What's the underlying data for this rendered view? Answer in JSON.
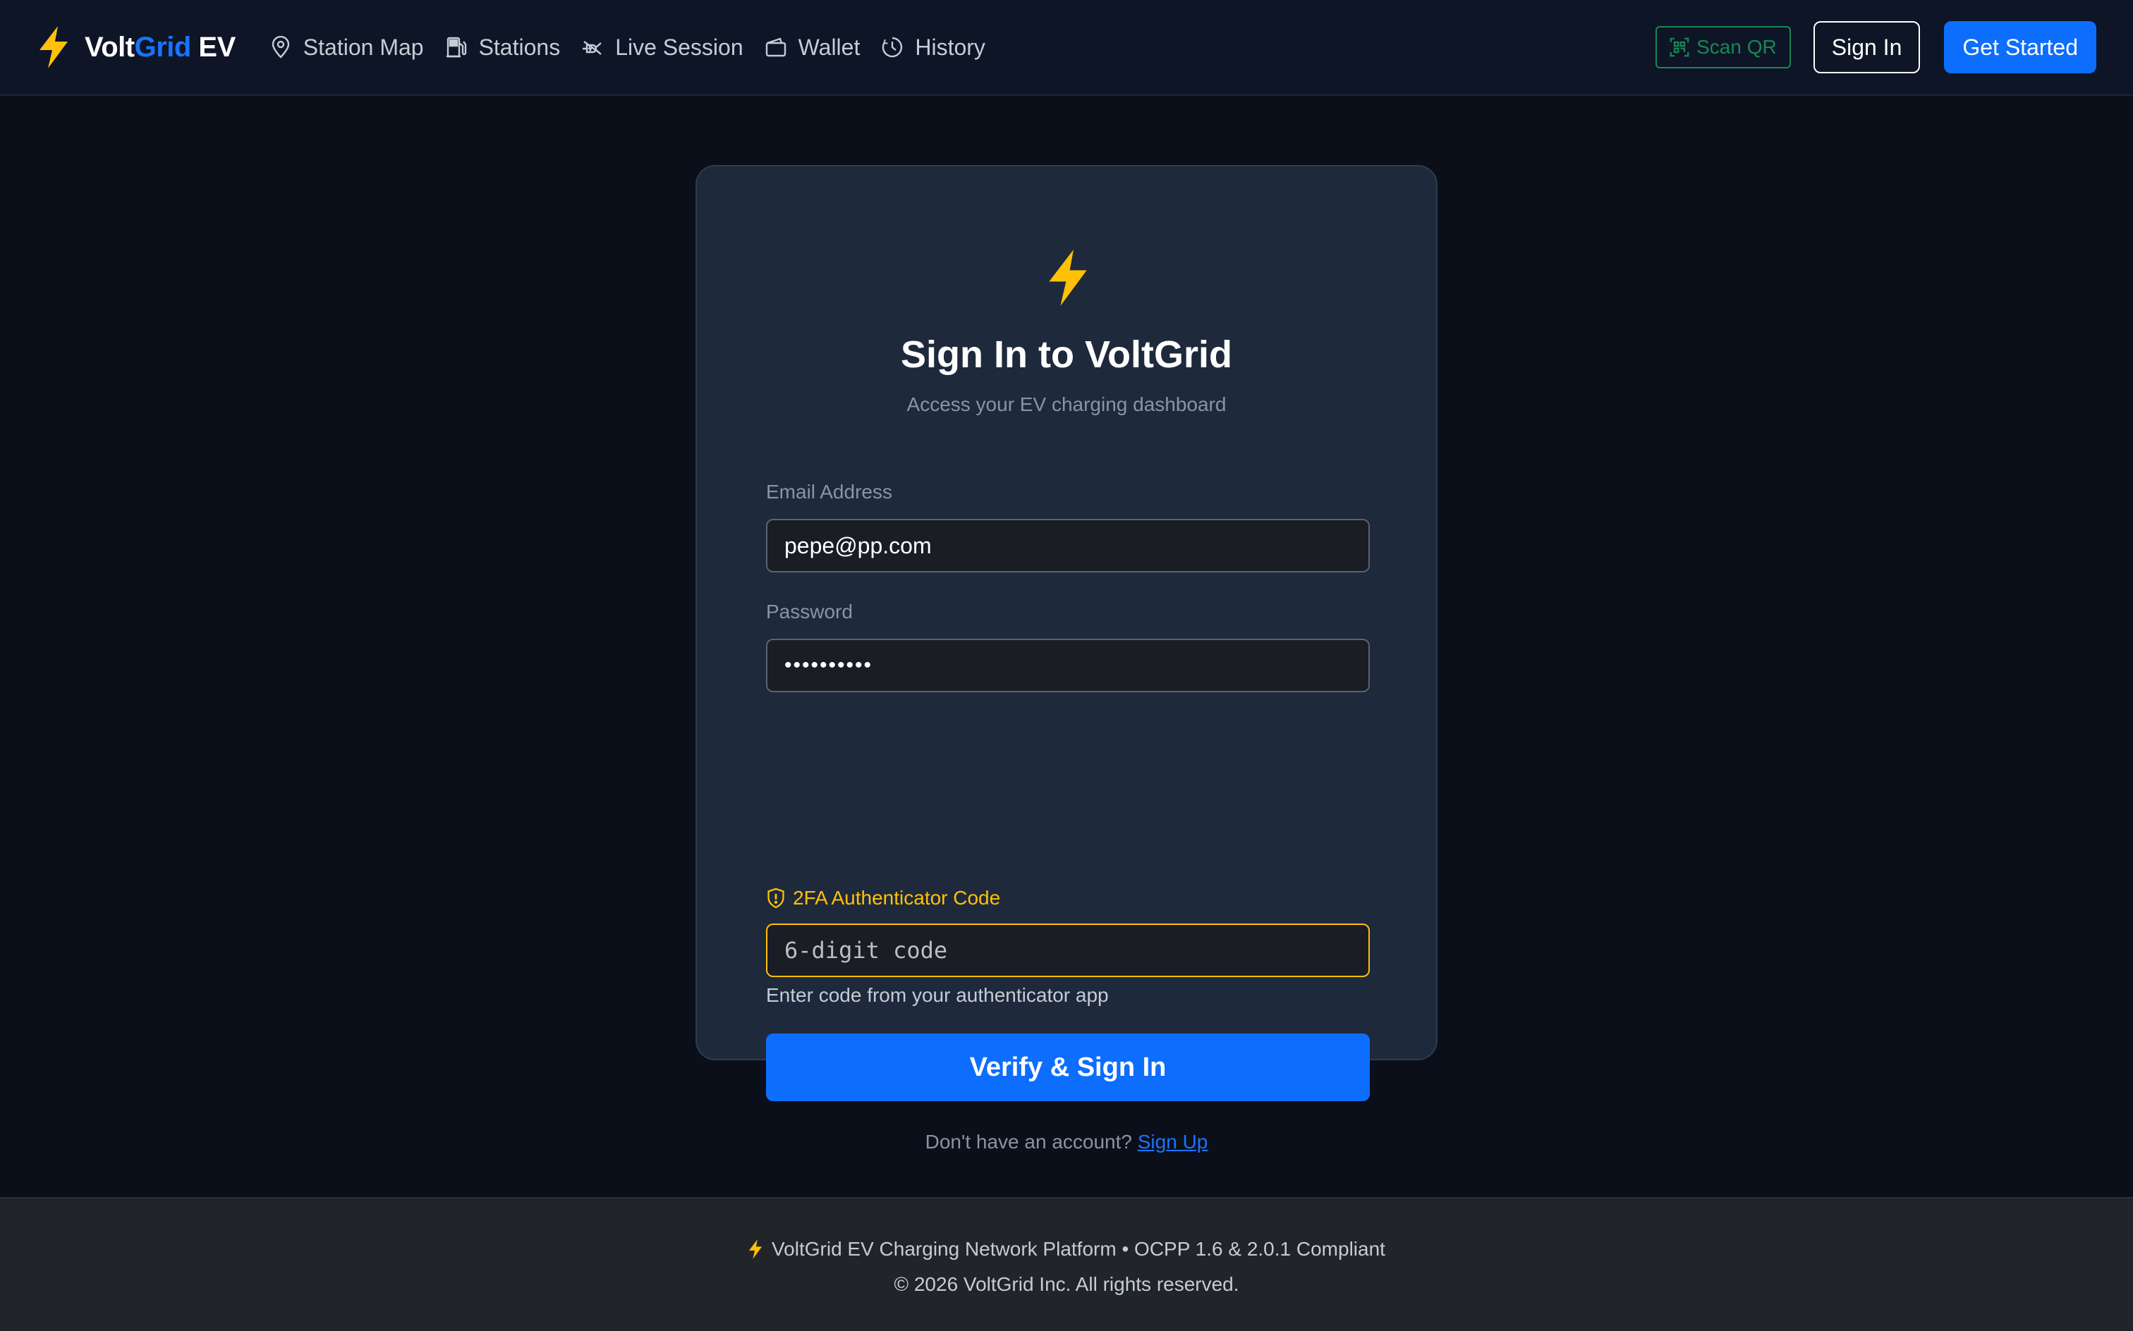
{
  "brand": {
    "name_part1": "Volt",
    "name_part2": "Grid",
    "name_part3": " EV",
    "accent_color": "#1a73ff",
    "logo_icon": "lightning-bolt-icon"
  },
  "nav": {
    "items": [
      {
        "label": "Station Map",
        "icon": "map-pin-icon"
      },
      {
        "label": "Stations",
        "icon": "fuel-pump-icon"
      },
      {
        "label": "Live Session",
        "icon": "ev-plug-icon"
      },
      {
        "label": "Wallet",
        "icon": "wallet-icon"
      },
      {
        "label": "History",
        "icon": "clock-icon"
      }
    ],
    "scan_qr_label": "Scan QR",
    "sign_in_label": "Sign In",
    "get_started_label": "Get Started"
  },
  "login": {
    "title": "Sign In to VoltGrid",
    "subtitle": "Access your EV charging dashboard",
    "email_label": "Email Address",
    "email_value": "pepe@pp.com",
    "password_label": "Password",
    "password_value": "••••••••••",
    "twofa_label": "2FA Authenticator Code",
    "twofa_placeholder": "6-digit code",
    "twofa_hint": "Enter code from your authenticator app",
    "submit_label": "Verify & Sign In",
    "signup_prompt": "Don't have an account?",
    "signup_link": "Sign Up"
  },
  "footer": {
    "line1": "VoltGrid EV Charging Network Platform • OCPP 1.6 & 2.0.1 Compliant",
    "line2": "© 2026 VoltGrid Inc. All rights reserved."
  },
  "colors": {
    "primary": "#0d6efd",
    "warning": "#ffc107",
    "success": "#198754",
    "background": "#0a0f1a",
    "card": "#1e293b"
  }
}
